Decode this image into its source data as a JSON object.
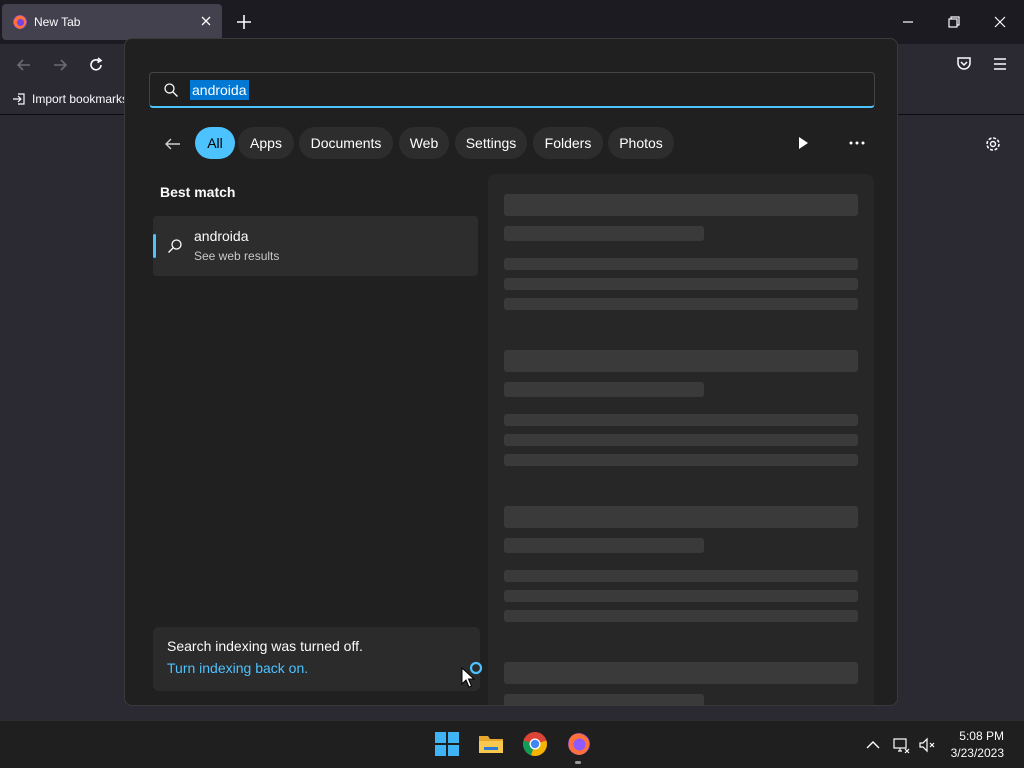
{
  "browser": {
    "tab_title": "New Tab",
    "bookmark_import_label": "Import bookmarks..."
  },
  "search": {
    "query": "androida",
    "filters": [
      {
        "label": "All",
        "active": true
      },
      {
        "label": "Apps"
      },
      {
        "label": "Documents"
      },
      {
        "label": "Web"
      },
      {
        "label": "Settings"
      },
      {
        "label": "Folders"
      },
      {
        "label": "Photos"
      }
    ],
    "best_match_heading": "Best match",
    "best_match": {
      "title": "androida",
      "subtitle": "See web results",
      "icon": "search-icon"
    },
    "indexing": {
      "message": "Search indexing was turned off.",
      "link": "Turn indexing back on."
    }
  },
  "taskbar": {
    "apps": [
      "windows-start-icon",
      "file-explorer-icon",
      "chrome-icon",
      "firefox-icon"
    ],
    "clock_time": "5:08 PM",
    "clock_date": "3/23/2023"
  },
  "colors": {
    "accent": "#4cc2ff",
    "selection": "#0078d4",
    "flyout_bg": "#202020"
  }
}
